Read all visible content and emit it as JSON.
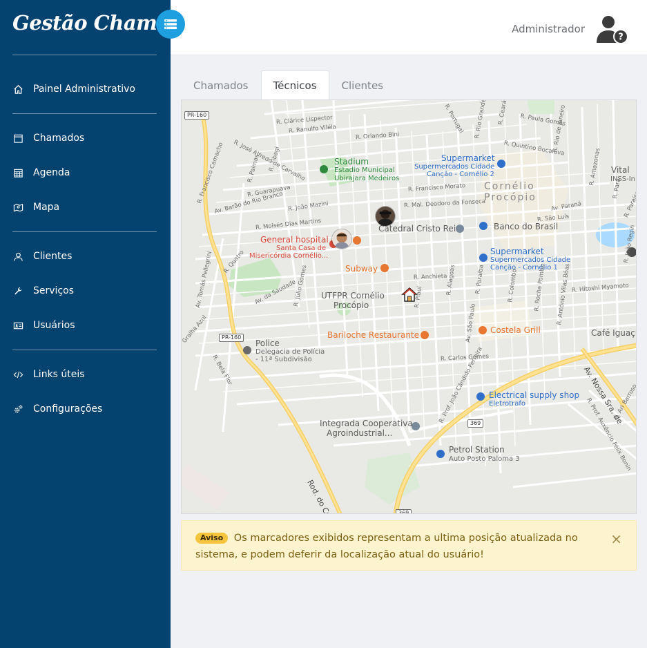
{
  "brand": {
    "title": "Gestão Chamados"
  },
  "sidebar": {
    "items": [
      {
        "label": "Painel Administrativo",
        "icon": "home-icon"
      },
      {
        "label": "Chamados",
        "icon": "calendar-icon"
      },
      {
        "label": "Agenda",
        "icon": "calendar-grid-icon"
      },
      {
        "label": "Mapa",
        "icon": "map-icon"
      },
      {
        "label": "Clientes",
        "icon": "user-icon"
      },
      {
        "label": "Serviços",
        "icon": "wrench-icon"
      },
      {
        "label": "Usuários",
        "icon": "id-card-icon"
      },
      {
        "label": "Links úteis",
        "icon": "code-icon"
      },
      {
        "label": "Configurações",
        "icon": "gears-icon"
      }
    ]
  },
  "header": {
    "user_name": "Administrador"
  },
  "tabs": [
    {
      "label": "Chamados",
      "active": false
    },
    {
      "label": "Técnicos",
      "active": true
    },
    {
      "label": "Clientes",
      "active": false
    }
  ],
  "map": {
    "labels": {
      "pr160_a": "PR-160",
      "pr160_b": "PR-160",
      "r369_a": "369",
      "r369_b": "369",
      "city": "Cornélio",
      "city2": "Procópio",
      "stadium": "Stadium",
      "stadium_sub1": "Estadio Municipal",
      "stadium_sub2": "Ubirajara Medeiros",
      "hospital": "General hospital",
      "hospital_sub1": "Santa Casa de",
      "hospital_sub2": "Misericórdia Cornélio...",
      "subway": "Subway",
      "catedral": "Catedral Cristo Rei",
      "banco": "Banco do Brasil",
      "supermarket1": "Supermarket",
      "supermarket1_sub1": "Supermercados Cidade",
      "supermarket1_sub2": "Canção - Cornélio 2",
      "supermarket2": "Supermarket",
      "supermarket2_sub1": "Supermercados Cidade",
      "supermarket2_sub2": "Canção - Cornélio 1",
      "utfpr": "UTFPR Cornélio",
      "utfpr2": "Procópio",
      "bariloche": "Bariloche Restaurante",
      "costela": "Costela Grill",
      "cafe": "Café Iguaçu",
      "police": "Police",
      "police_sub1": "Delegacia de Polícia",
      "police_sub2": "- 11ª Subdivisão",
      "electrical": "Electrical supply shop",
      "electrical_sub": "Eletrotrafo",
      "integrada": "Integrada Cooperativa",
      "integrada2": "Agroindustrial...",
      "petrol": "Petrol Station",
      "petrol_sub": "Auto Posto Paloma 3",
      "rod": "Rod. do Contorno",
      "av_nossa": "Av. Nossa Sra. de",
      "inss": "INSS-In",
      "vital": "Vital",
      "st1": "R. Clárice Lispector",
      "st2": "R. Ranulfo Viléla",
      "st3": "R. José Alfredo de Carvalho",
      "st4": "R. Orlando Bini",
      "st5": "R. Francisco Morato",
      "st6": "R. Mal. Deodoro da Fonseca",
      "st7": "R. João Mazini",
      "st8": "Av. Barão do Rio Branco",
      "st9": "R. Moisés Dias Martins",
      "st10": "R. Quintino Bocaiúva",
      "st11": "R. Paula Gomes",
      "st12": "R. Anchieta",
      "st13": "R. Hitoshi Myamoto",
      "st14": "R. Carlos Gomes",
      "st15": "R. Prof. João Cândido Ferreira",
      "st16": "Av. da Saudade",
      "st17": "Av. Tomás Pellegrini",
      "st18": "R. Júlio Gomes",
      "st19": "R. Guarapuava",
      "st20": "Av. Paraná",
      "st21": "R. São Luís",
      "st22": "R. Paraíba",
      "st23": "R. Colombo",
      "st24": "R. Rocha Pombo",
      "st25": "R. Antônio Vilas Bôas",
      "st26": "R. Alagoas",
      "st27": "R. Piauí",
      "st28": "Av. São Paulo",
      "st29": "R. Francisco Camacho",
      "st30": "R. Palmas",
      "st31": "R. Tibagi",
      "st32": "R. Quatro",
      "st33": "R. Bela Flor",
      "st34": "Gralha Azul",
      "st35": "R. Portugal",
      "st36": "R. Rio Grande do Norte",
      "st37": "R. Ceará",
      "st38": "R. Rio de Janeiro",
      "st39": "R. Amazonas",
      "st40": "R. Pará",
      "st41": "R. Prof. Auxêncio Félix Bonin",
      "st42": "R. Ari Barroso",
      "st43": "R. Paraíso",
      "st44": "R. João Regin"
    }
  },
  "alert": {
    "badge": "Aviso",
    "message": "Os marcadores exibidos representam a ultima posição atualizada no sistema, e podem deferir da localização atual do usuário!",
    "close": "×"
  }
}
